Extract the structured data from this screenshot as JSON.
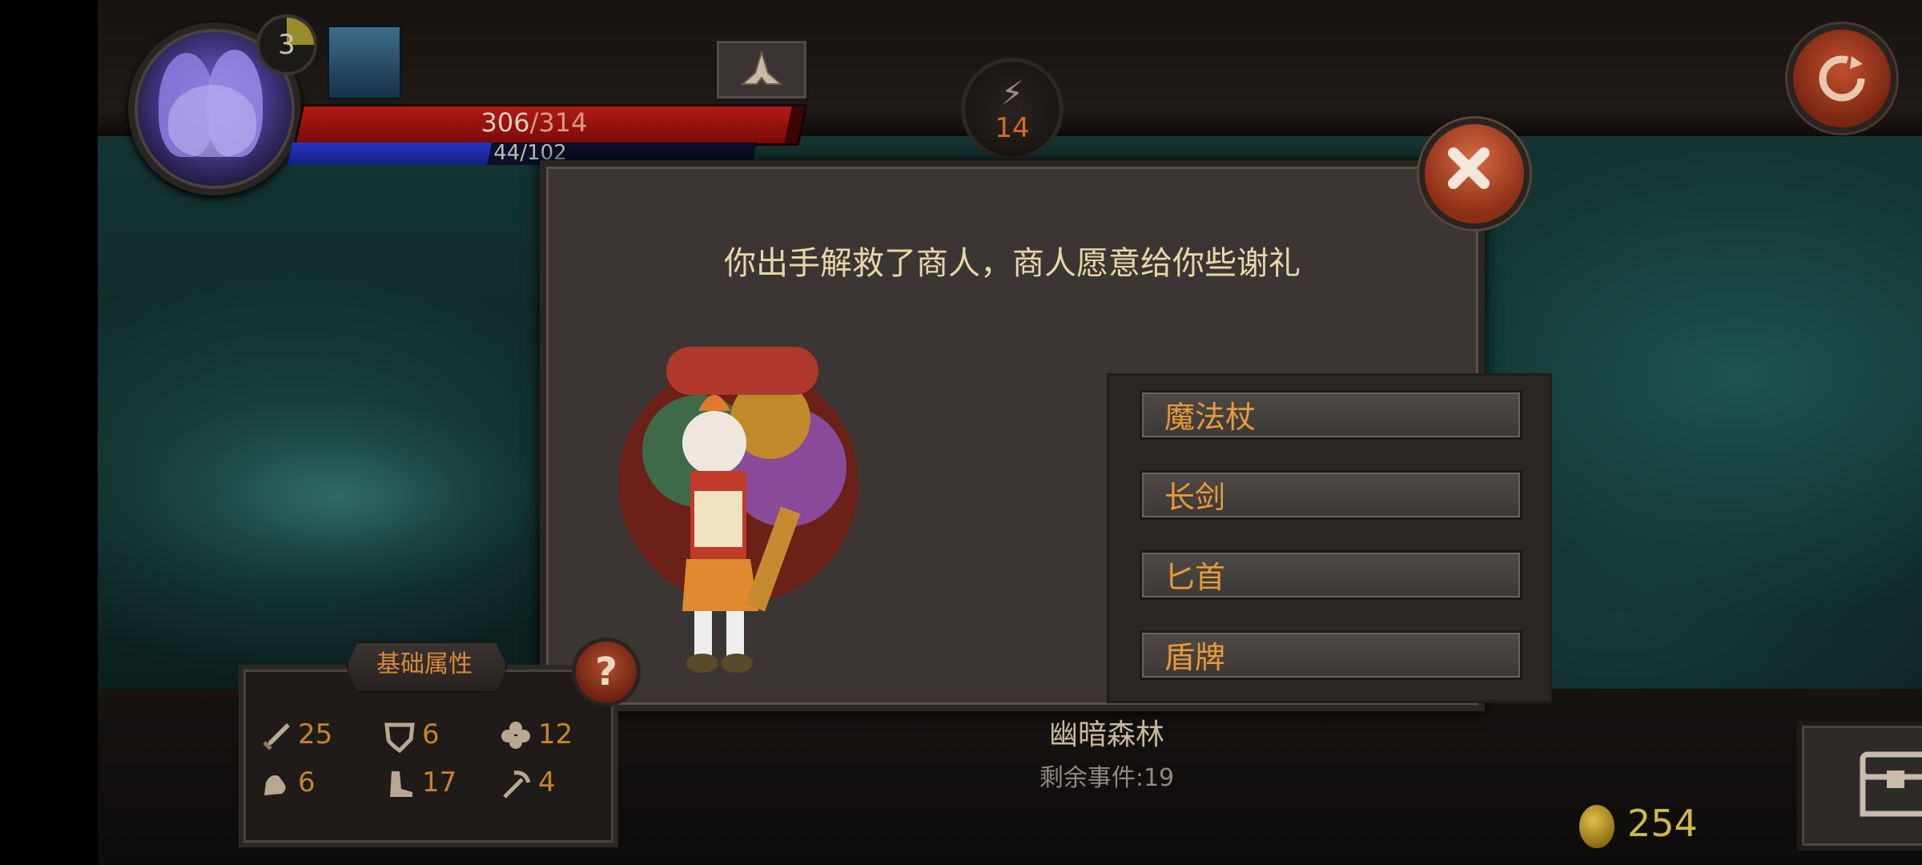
{
  "player": {
    "level": "3",
    "hp_current": "306",
    "hp_max": "/314",
    "hp_fraction": 0.975,
    "mp_text": "44/102",
    "mp_fraction": 0.43
  },
  "energy": {
    "value": "14",
    "icon": "lightning-icon"
  },
  "dialog": {
    "title": "你出手解救了商人，商人愿意给你些谢礼",
    "options": [
      "魔法杖",
      "长剑",
      "匕首",
      "盾牌"
    ]
  },
  "stats": {
    "header": "基础属性",
    "help": "?",
    "attack": "25",
    "defense": "6",
    "luck": "12",
    "strength": "6",
    "agility": "17",
    "pickaxe": "4"
  },
  "location": {
    "name": "幽暗森林",
    "events": "剩余事件:19"
  },
  "gold": "254",
  "colors": {
    "accent": "#e89a38",
    "title": "#e8d7a8",
    "hp": "#b21a14",
    "mp": "#2436c6"
  }
}
